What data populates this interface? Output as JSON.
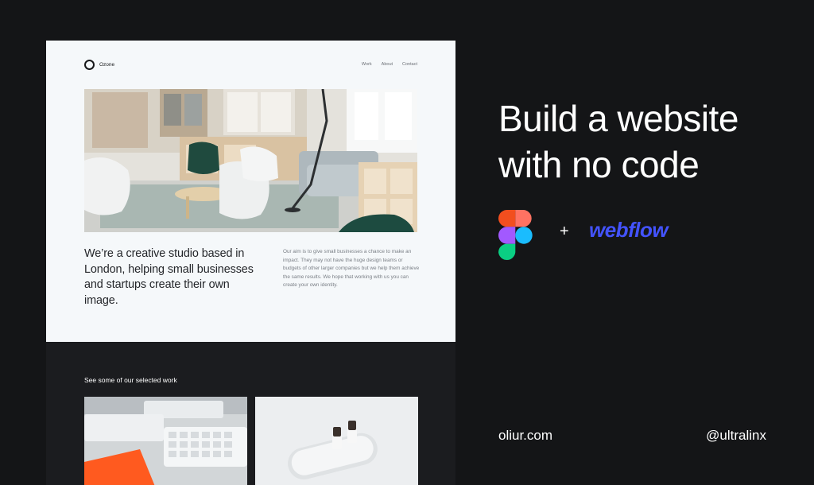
{
  "site": {
    "brand": "Ozone",
    "nav": [
      "Work",
      "About",
      "Contact"
    ],
    "headline": "We’re a creative studio based in London, helping small businesses and startups create their own image.",
    "paragraph": "Our aim is to give small businesses a chance to make an impact. They may not have the huge design teams or budgets of other larger companies but we help them achieve the same results. We hope that working with us you can create your own identity.",
    "work_heading": "See some of our selected work"
  },
  "promo": {
    "title": "Build a website with no code",
    "plus": "+",
    "webflow": "webflow",
    "footer_left": "oliur.com",
    "footer_right": "@ultralinx"
  },
  "colors": {
    "background": "#141517",
    "site_light": "#f5f8fa",
    "site_dark": "#1b1c1f",
    "webflow_blue": "#4353ff",
    "figma_red": "#f24e1e",
    "figma_orange": "#ff7262",
    "figma_purple": "#a259ff",
    "figma_blue": "#1abcfe",
    "figma_green": "#0acf83"
  },
  "icons": [
    "figma-logo-icon",
    "ozone-logo-icon"
  ]
}
